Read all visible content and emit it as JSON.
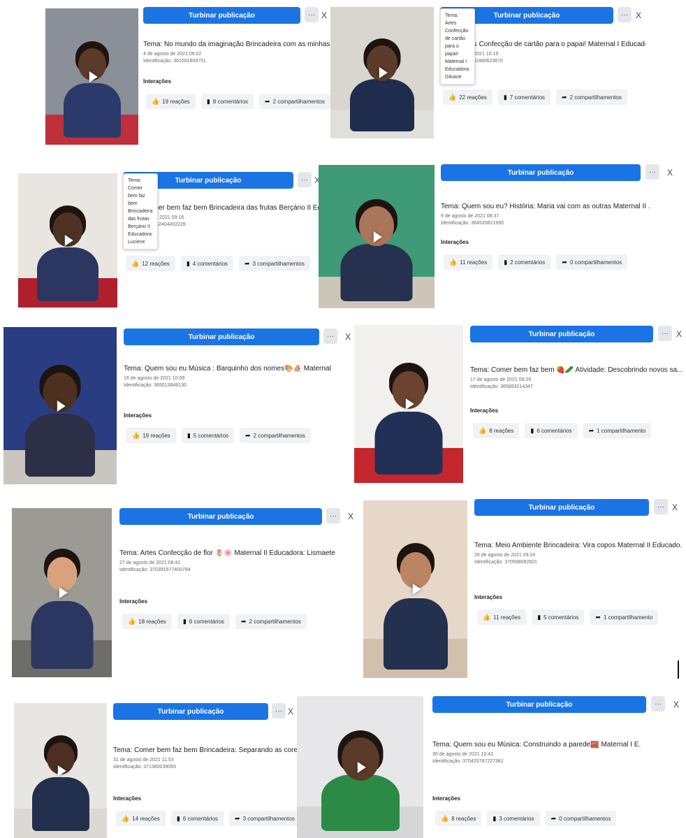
{
  "common": {
    "boost_label": "Turbinar publicação",
    "more_label": "···",
    "close_label": "X",
    "interactions_label": "Interações"
  },
  "colors": {
    "boost": "#1b74e4",
    "pill": "#f0f2f5"
  },
  "posts": [
    {
      "title": "Tema: No mundo da imaginação Brincadeira com as minhas mãos ..",
      "date": "4 de agosto de 2021 09:02",
      "ident": "Identificação: 361591809751",
      "reactions": "19 reações",
      "comments": "8 comentários",
      "shares": "2 compartilhamentos"
    },
    {
      "title": "Tema: Artes Confecção de cartão para o papai! Maternal I Educado...",
      "date": "6 de agosto de 2021 10:19",
      "ident": "Identificação: 362480623670",
      "reactions": "22 reações",
      "comments": "7 comentários",
      "shares": "2 compartilhamentos",
      "tooltip": [
        "Tema: Artes Confecção de cartão para o papai!",
        "Maternal I Educadora: Gilvane"
      ]
    },
    {
      "title": "Tema: Comer bem faz bem Brincadeira das frutas Berçário II Educ",
      "date": "10 de agosto de 2021 09:16",
      "ident": "Identificação: 362404402226",
      "reactions": "12 reações",
      "comments": "4 comentários",
      "shares": "3 compartilhamentos",
      "tooltip": [
        "Tema: Comer bem faz bem Brincadeira das frutas",
        "Berçário II Educadora: Luciene"
      ]
    },
    {
      "title": "Tema: Quem sou eu? História: Maria vai com as outras Maternal II .",
      "date": "9 de agosto de 2021 08:37",
      "ident": "Identificação: 364520821930",
      "reactions": "11 reações",
      "comments": "2 comentários",
      "shares": "0 compartilhamentos"
    },
    {
      "title": "Tema: Quem sou eu Música : Barquinho dos nomes🎨⛵ Maternal",
      "date": "16 de agosto de 2021 10:09",
      "ident": "Identificação: 365013848130",
      "reactions": "19 reações",
      "comments": "5 comentários",
      "shares": "2 compartilhamentos"
    },
    {
      "title": "Tema: Comer bem faz bem 🍓🥒 Atividade: Descobrindo novos sa...",
      "date": "17 de agosto de 2021 08:29",
      "ident": "Identificação: 365893214347",
      "reactions": "8 reações",
      "comments": "6 comentários",
      "shares": "1 compartilhamento"
    },
    {
      "title": "Tema: Artes Confecção de flor 🌷🌸 Maternal II Educadora: Lismaete",
      "date": "27 de agosto de 2021 08:42",
      "ident": "Identificação: 370391577400794",
      "reactions": "18 reações",
      "comments": "6 comentários",
      "shares": "2 compartilhamentos"
    },
    {
      "title": "Tema: Meio Ambiente Brincadeira: Vira copos Maternal II Educado...",
      "date": "26 de agosto de 2021 09:24",
      "ident": "Identificação: 370598082601",
      "reactions": "11 reações",
      "comments": "5 comentários",
      "shares": "1 compartilhamento"
    },
    {
      "title": "Tema: Comer bem faz bem Brincadeira: Separando as cores das al...",
      "date": "31 de agosto de 2021 11:53",
      "ident": "Identificação: 371380039093",
      "reactions": "14 reações",
      "comments": "6 comentários",
      "shares": "3 compartilhamentos"
    },
    {
      "title": "Tema: Quem sou eu Música: Construindo a parede🧱 Maternal I E.",
      "date": "30 de agosto de 2021 10:41",
      "ident": "Identificação: 370425787227381",
      "reactions": "8 reações",
      "comments": "3 comentários",
      "shares": "0 compartilhamentos"
    }
  ]
}
